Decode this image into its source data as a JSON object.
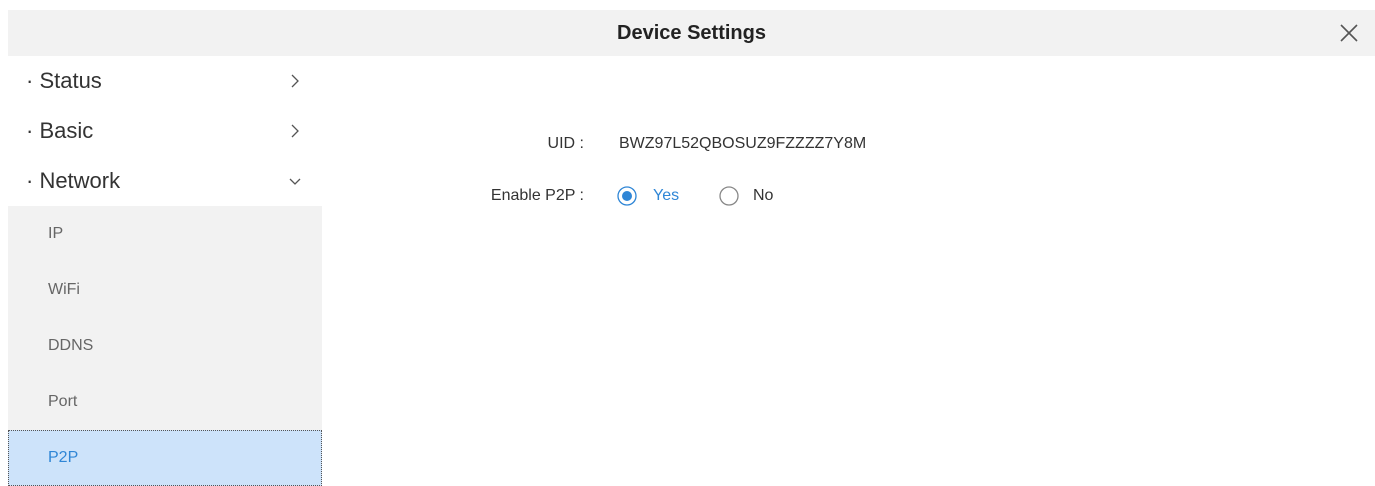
{
  "window": {
    "title": "Device Settings",
    "close_icon": "close-icon"
  },
  "sidebar": {
    "sections": [
      {
        "label": "· Status",
        "state": "collapsed"
      },
      {
        "label": "· Basic",
        "state": "collapsed"
      },
      {
        "label": "· Network",
        "state": "expanded"
      }
    ],
    "network_items": [
      {
        "label": "IP"
      },
      {
        "label": "WiFi"
      },
      {
        "label": "DDNS"
      },
      {
        "label": "Port"
      },
      {
        "label": "P2P",
        "selected": true
      }
    ]
  },
  "p2p": {
    "uid_label": "UID :",
    "uid_value": "BWZ97L52QBOSUZ9FZZZZ7Y8M",
    "enable_label": "Enable P2P :",
    "options": [
      {
        "label": "Yes",
        "checked": true
      },
      {
        "label": "No",
        "checked": false
      }
    ]
  },
  "colors": {
    "accent": "#2f86d6",
    "selected_bg": "#cde3fa",
    "header_bg": "#f2f2f2"
  }
}
